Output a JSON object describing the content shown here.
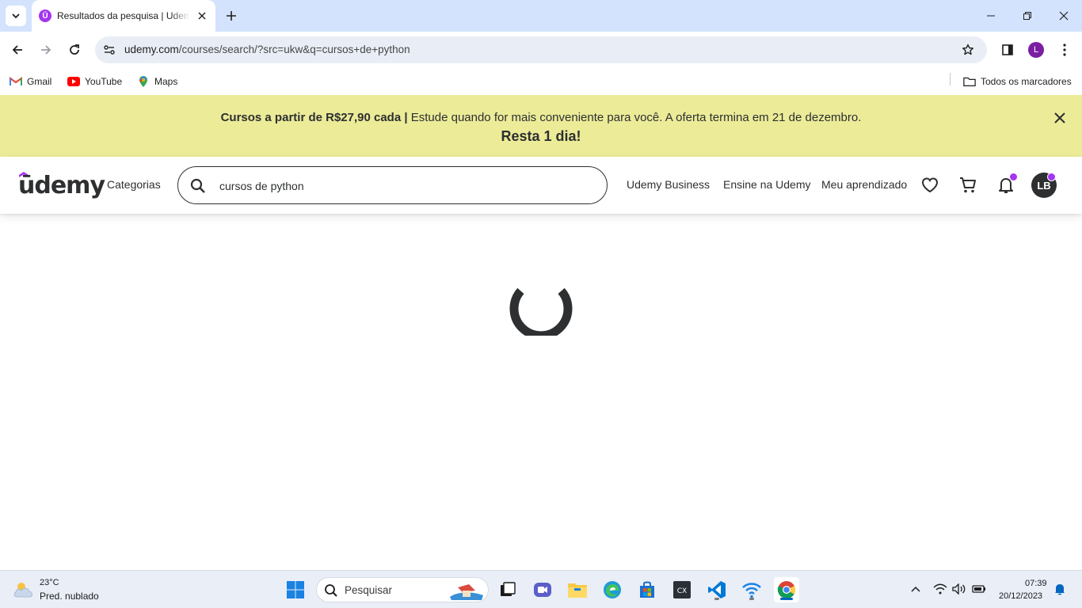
{
  "browser": {
    "tab_title": "Resultados da pesquisa | Udemy",
    "url_host": "udemy.com",
    "url_path": "/courses/search/?src=ukw&q=cursos+de+python",
    "profile_initial": "L",
    "bookmarks": [
      {
        "label": "Gmail",
        "icon": "gmail-icon"
      },
      {
        "label": "YouTube",
        "icon": "youtube-icon"
      },
      {
        "label": "Maps",
        "icon": "maps-icon"
      }
    ],
    "all_bookmarks_label": "Todos os marcadores"
  },
  "promo": {
    "bold_text": "Cursos a partir de R$27,90 cada |",
    "text": " Estude quando for mais conveniente para você. A oferta termina em 21 de dezembro.",
    "countdown": "Resta 1 dia!"
  },
  "header": {
    "logo_text": "ūdemy",
    "categories_label": "Categorias",
    "search_value": "cursos de python",
    "business_label": "Udemy Business",
    "teach_label": "Ensine na Udemy",
    "learning_label": "Meu aprendizado",
    "avatar_initials": "LB",
    "accent_color": "#a435f0"
  },
  "main": {
    "state": "loading"
  },
  "taskbar": {
    "weather_temp": "23°C",
    "weather_desc": "Pred. nublado",
    "search_placeholder": "Pesquisar",
    "time": "07:39",
    "date": "20/12/2023"
  }
}
